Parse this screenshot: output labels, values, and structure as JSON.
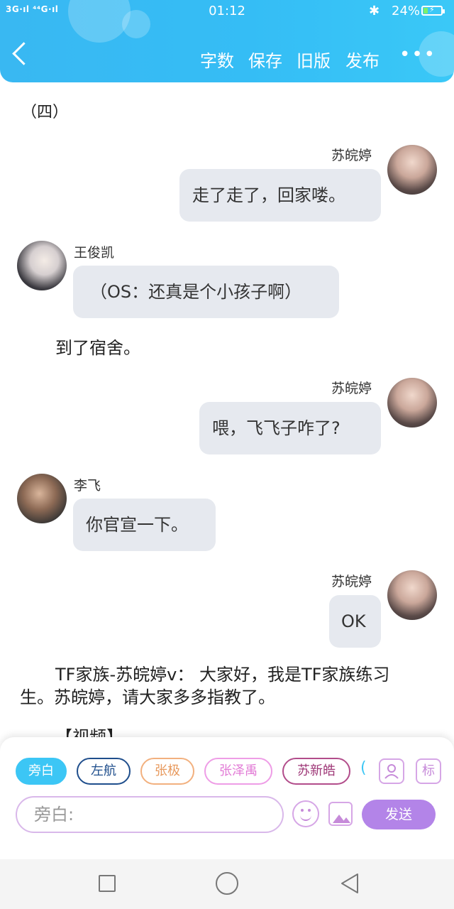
{
  "status_bar": {
    "signal": "3G·ıl ⁴⁴G·ıl",
    "time": "01:12",
    "battery": "24%"
  },
  "header": {
    "menu": [
      "字数",
      "保存",
      "旧版",
      "发布"
    ],
    "more": "•••"
  },
  "content": {
    "section_title": "（四）",
    "messages": [
      {
        "speaker": "苏皖婷",
        "text": "走了走了，回家喽。"
      },
      {
        "speaker": "王俊凯",
        "text": "（OS：还真是个小孩子啊）"
      },
      {
        "narration": "到了宿舍。"
      },
      {
        "speaker": "苏皖婷",
        "text": "喂，飞飞子咋了?"
      },
      {
        "speaker": "李飞",
        "text": "你官宣一下。"
      },
      {
        "speaker": "苏皖婷",
        "text": "OK"
      }
    ],
    "narration_block": {
      "line1": "TF家族-苏皖婷v： 大家好，我是TF家族练习",
      "line2": "生。苏皖婷，请大家多多指教了。"
    },
    "cut_text": "【视频】"
  },
  "panel": {
    "chips": [
      "旁白",
      "左航",
      "张极",
      "张泽禹",
      "苏新皓"
    ],
    "chip_more": "(",
    "tag_icon_label": "标",
    "input_placeholder": "旁白:",
    "send_label": "发送"
  },
  "colors": {
    "header": "#39b8f2",
    "chip_active": "#3cc6f5",
    "send": "#b384e8"
  }
}
